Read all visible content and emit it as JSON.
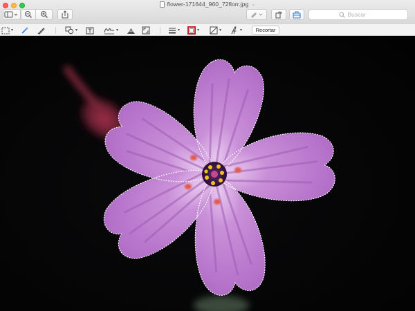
{
  "window": {
    "title": "flower-171644_960_72florr.jpg"
  },
  "toolbar": {
    "search_placeholder": "Buscar"
  },
  "markup_toolbar": {
    "crop_label": "Recortar"
  },
  "colors": {
    "close": "#fc605c",
    "minimize": "#fdbc40",
    "zoom": "#34c84a",
    "petal": "#c98fd6",
    "petal_vein": "#8e4a9c",
    "stamen": "#f2c21a",
    "anther": "#e05a4a",
    "selection": "#ffffff"
  },
  "icons": [
    "sidebar-icon",
    "zoom-out-icon",
    "zoom-in-icon",
    "share-icon",
    "pen-icon",
    "rotate-icon",
    "toolbox-icon",
    "search-icon",
    "rect-selection-icon",
    "magic-wand-icon",
    "sketch-icon",
    "shapes-icon",
    "text-icon",
    "sign-icon",
    "adjust-color-icon",
    "resize-icon",
    "line-style-icon",
    "border-color-icon",
    "fill-color-icon",
    "text-style-icon"
  ]
}
